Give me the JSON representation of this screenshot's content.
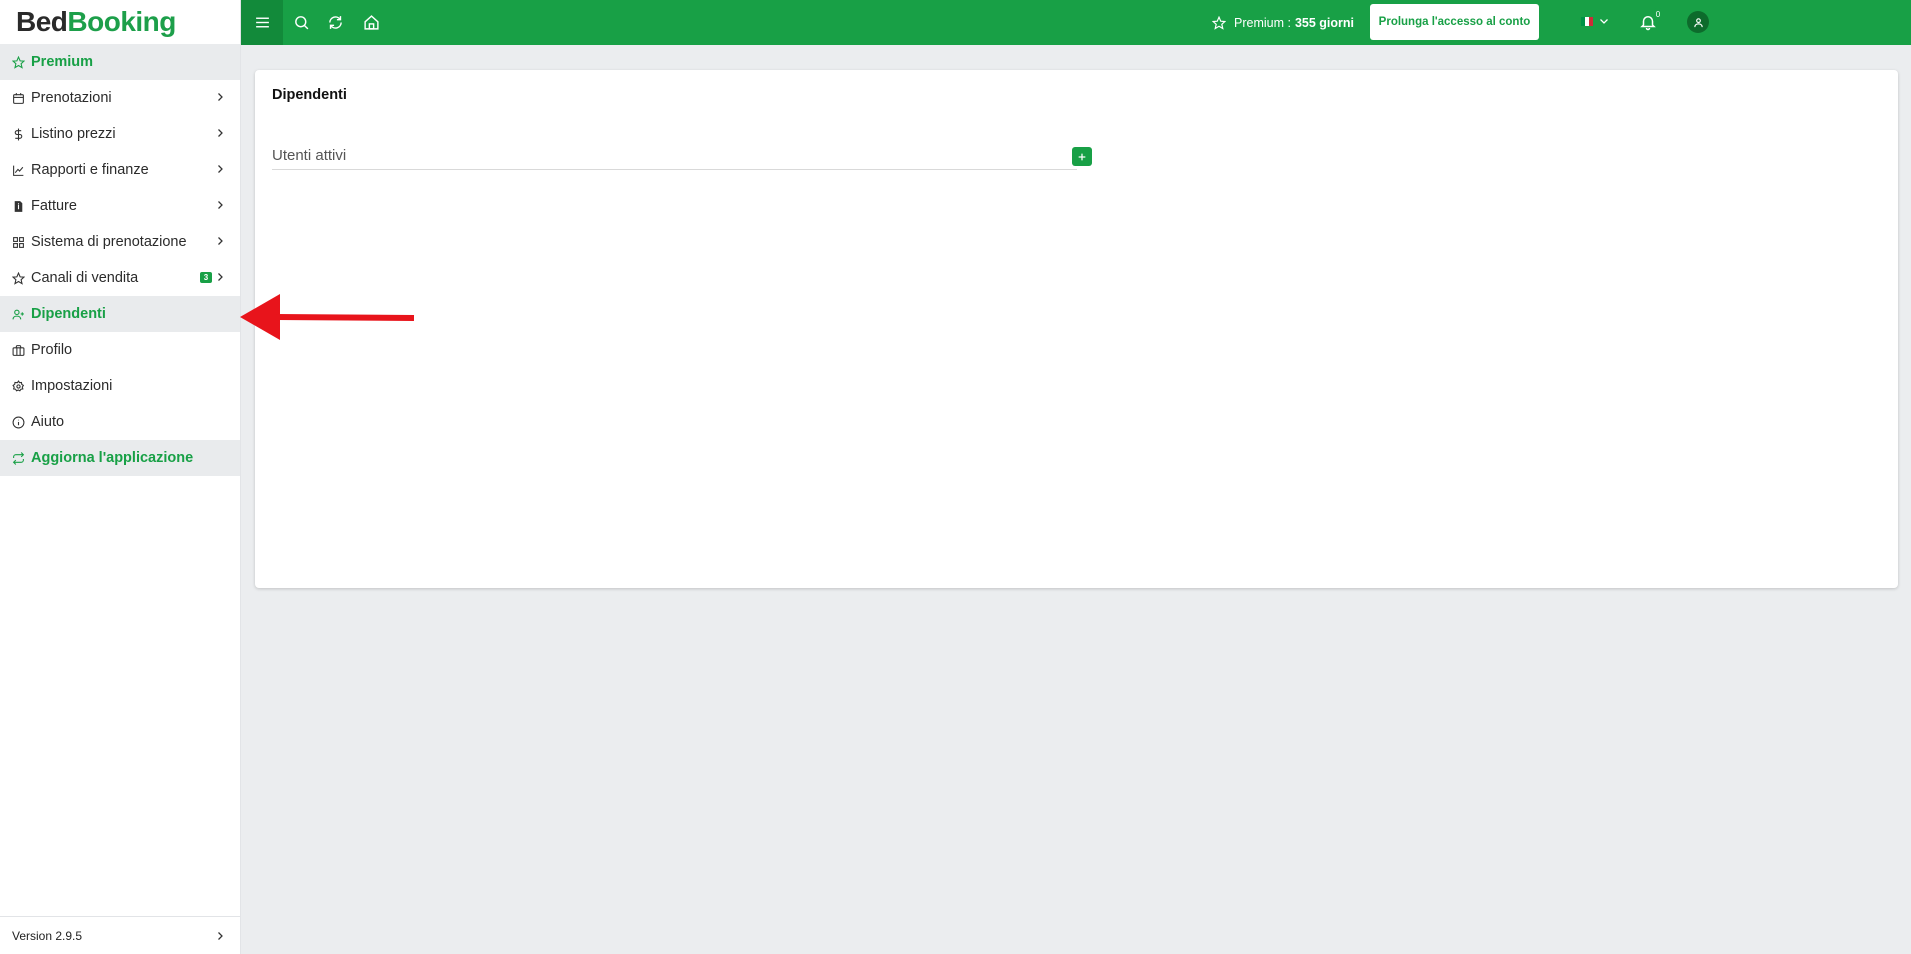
{
  "brand": {
    "part1": "Bed",
    "part2": "Booking",
    "accent": "#18a046"
  },
  "sidebar": {
    "items": [
      {
        "label": "Premium",
        "icon": "star-icon",
        "highlight": true,
        "chevron": false
      },
      {
        "label": "Prenotazioni",
        "icon": "calendar-icon",
        "highlight": false,
        "chevron": true
      },
      {
        "label": "Listino prezzi",
        "icon": "dollar-icon",
        "highlight": false,
        "chevron": true
      },
      {
        "label": "Rapporti e finanze",
        "icon": "chart-icon",
        "highlight": false,
        "chevron": true
      },
      {
        "label": "Fatture",
        "icon": "invoice-icon",
        "highlight": false,
        "chevron": true
      },
      {
        "label": "Sistema di prenotazione",
        "icon": "grid-icon",
        "highlight": false,
        "chevron": true
      },
      {
        "label": "Canali di vendita",
        "icon": "star-icon",
        "highlight": false,
        "chevron": true,
        "badge": "3"
      },
      {
        "label": "Dipendenti",
        "icon": "user-plus-icon",
        "highlight": true,
        "chevron": false
      },
      {
        "label": "Profilo",
        "icon": "briefcase-icon",
        "highlight": false,
        "chevron": false
      },
      {
        "label": "Impostazioni",
        "icon": "gear-icon",
        "highlight": false,
        "chevron": false
      },
      {
        "label": "Aiuto",
        "icon": "info-icon",
        "highlight": false,
        "chevron": false
      },
      {
        "label": "Aggiorna l'applicazione",
        "icon": "refresh-icon",
        "highlight": true,
        "chevron": false
      }
    ],
    "version": "Version 2.9.5"
  },
  "topbar": {
    "premium_label": "Premium :",
    "premium_days": "355 giorni",
    "extend_button": "Prolunga l'accesso al conto",
    "notifications_count": "0",
    "language": "it"
  },
  "main": {
    "title": "Dipendenti",
    "section_label": "Utenti attivi"
  }
}
